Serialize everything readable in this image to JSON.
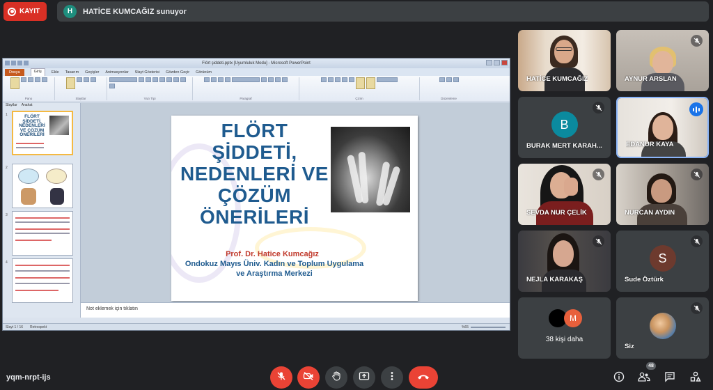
{
  "recording": {
    "label": "KAYIT"
  },
  "presenter": {
    "initial": "H",
    "text": "HATİCE KUMCAĞIZ sunuyor"
  },
  "powerpoint": {
    "window_title": "Flört şiddeti.pptx [Uyumluluk Modu] - Microsoft PowerPoint",
    "file_tab": "Dosya",
    "tabs": [
      "Giriş",
      "Ekle",
      "Tasarım",
      "Geçişler",
      "Animasyonlar",
      "Slayt Gösterisi",
      "Gözden Geçir",
      "Görünüm"
    ],
    "ribbon_groups": [
      "Pano",
      "Slaytlar",
      "Yazı Tipi",
      "Paragraf",
      "Çizim",
      "Düzenleme"
    ],
    "thumb_tabs": [
      "Slaytlar",
      "Anahat"
    ],
    "slide": {
      "title": "FLÖRT ŞİDDETİ, NEDENLERİ VE ÇÖZÜM ÖNERİLERİ",
      "author": "Prof. Dr. Hatice Kumcağız",
      "affiliation": "Ondokuz Mayıs Üniv. Kadın ve Toplum Uygulama ve Araştırma Merkezi"
    },
    "notes_placeholder": "Not eklemek için tıklatın",
    "status_slide": "Slayt 1 / 16",
    "status_theme": "Retrospekt",
    "zoom": "%65"
  },
  "participants": [
    {
      "name": "HATİCE KUMCAĞIZ",
      "muted": false
    },
    {
      "name": "AYNUR ARSLAN",
      "muted": true
    },
    {
      "name": "BURAK MERT KARAH...",
      "muted": true,
      "initial": "B",
      "avatar_color": "#0b8a9e"
    },
    {
      "name": "EDANUR KAYA",
      "muted": false,
      "speaking": true
    },
    {
      "name": "SEVDA NUR ÇELİK",
      "muted": true
    },
    {
      "name": "NURCAN AYDIN",
      "muted": true
    },
    {
      "name": "NEJLA KARAKAŞ",
      "muted": true
    },
    {
      "name": "Sude Öztürk",
      "muted": true,
      "initial": "S",
      "avatar_color": "#6d3a2e"
    },
    {
      "name": "38 kişi daha",
      "muted": false,
      "initial": "M",
      "avatar_color": "#e8603c"
    },
    {
      "name": "Siz",
      "muted": true
    }
  ],
  "bottom": {
    "meeting_code": "yqm-nrpt-ijs",
    "people_count": "48"
  },
  "colors": {
    "bar_red": "#ea4335",
    "control_dark": "#3c4043",
    "background": "#202124"
  }
}
